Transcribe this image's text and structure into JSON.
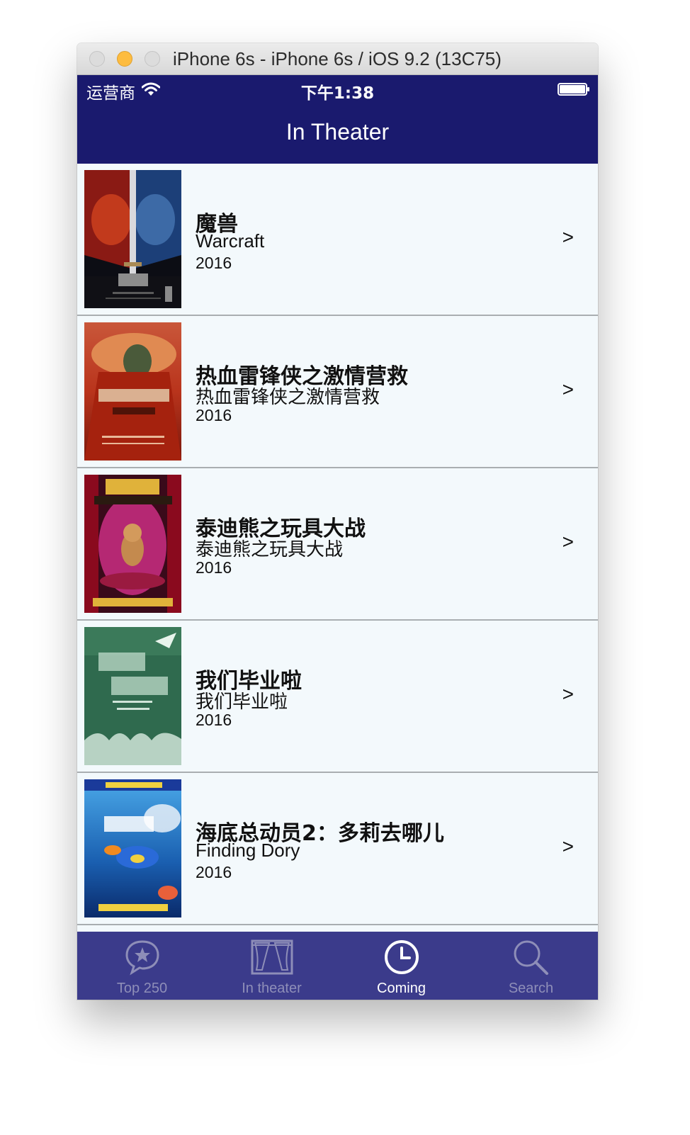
{
  "window": {
    "title": "iPhone 6s - iPhone 6s / iOS 9.2 (13C75)"
  },
  "statusbar": {
    "carrier": "运营商",
    "time": "下午1:38"
  },
  "navbar": {
    "title": "In Theater"
  },
  "movies": [
    {
      "title": "魔兽",
      "subtitle": "Warcraft",
      "year": "2016",
      "chevron": ">"
    },
    {
      "title": "热血雷锋侠之激情营救",
      "subtitle": "热血雷锋侠之激情营救",
      "year": "2016",
      "chevron": ">"
    },
    {
      "title": "泰迪熊之玩具大战",
      "subtitle": "泰迪熊之玩具大战",
      "year": "2016",
      "chevron": ">"
    },
    {
      "title": "我们毕业啦",
      "subtitle": "我们毕业啦",
      "year": "2016",
      "chevron": ">"
    },
    {
      "title": "海底总动员2：多莉去哪儿",
      "subtitle": "Finding Dory",
      "year": "2016",
      "chevron": ">"
    }
  ],
  "tabbar": {
    "tabs": [
      {
        "label": "Top 250",
        "icon": "star-bubble-icon",
        "active": false
      },
      {
        "label": "In theater",
        "icon": "theater-curtain-icon",
        "active": false
      },
      {
        "label": "Coming",
        "icon": "clock-icon",
        "active": true
      },
      {
        "label": "Search",
        "icon": "search-icon",
        "active": false
      }
    ]
  },
  "colors": {
    "navbar": "#1a1a6e",
    "tabbar": "#3b3b8b",
    "row_background": "#f3f9fc",
    "tab_inactive": "#8e8eb8",
    "tab_active": "#ffffff"
  }
}
